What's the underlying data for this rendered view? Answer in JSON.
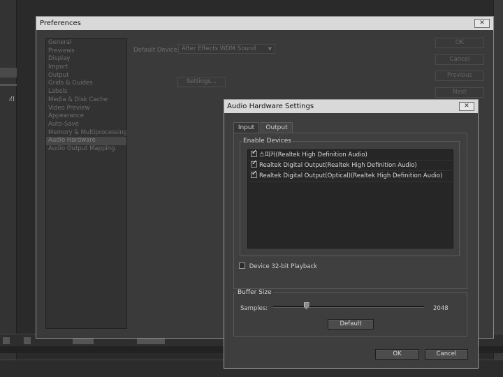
{
  "preferences": {
    "title": "Preferences",
    "close_label": "✕",
    "categories": [
      "General",
      "Previews",
      "Display",
      "Import",
      "Output",
      "Grids & Guides",
      "Labels",
      "Media & Disk Cache",
      "Video Preview",
      "Appearance",
      "Auto-Save",
      "Memory & Multiprocessing",
      "Audio Hardware",
      "Audio Output Mapping"
    ],
    "selected_category": "Audio Hardware",
    "default_device_label": "Default Device:",
    "default_device_value": "After Effects WDM Sound",
    "settings_button": "Settings...",
    "ok_button": "OK",
    "cancel_button": "Cancel",
    "previous_button": "Previous",
    "next_button": "Next"
  },
  "audio_hardware": {
    "title": "Audio Hardware Settings",
    "close_label": "✕",
    "tabs": [
      {
        "label": "Input",
        "active": false
      },
      {
        "label": "Output",
        "active": true
      }
    ],
    "enable_devices_label": "Enable Devices",
    "devices": [
      {
        "label": "스피커(Realtek High Definition Audio)",
        "checked": true
      },
      {
        "label": "Realtek Digital Output(Realtek High Definition Audio)",
        "checked": true
      },
      {
        "label": "Realtek Digital Output(Optical)(Realtek High Definition Audio)",
        "checked": true
      }
    ],
    "device_32bit_label": "Device 32-bit Playback",
    "device_32bit_checked": false,
    "buffer_size_label": "Buffer Size",
    "samples_label": "Samples:",
    "samples_value": "2048",
    "samples_slider_fraction": 0.22,
    "default_button": "Default",
    "ok_button": "OK",
    "cancel_button": "Cancel"
  },
  "icons": {
    "flowchart": "flowchart-icon",
    "checkmark": "checkmark-icon",
    "dropdown": "chevron-down-icon",
    "close": "close-icon"
  }
}
